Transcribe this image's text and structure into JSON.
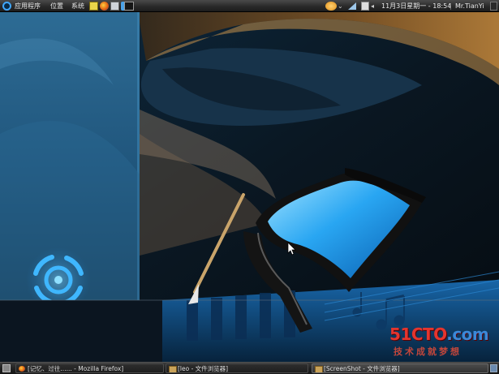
{
  "top_panel": {
    "menus": [
      "应用程序",
      "位置",
      "系统"
    ],
    "clock": "11月3日星期一 - 18:54",
    "user": "Mr.TianYi"
  },
  "taskbar": {
    "items": [
      {
        "label": "[记忆、过往...... - Mozilla Firefox]",
        "active": false
      },
      {
        "label": "[leo - 文件浏览器]",
        "active": false
      },
      {
        "label": "[ScreenShot - 文件浏览器]",
        "active": true
      }
    ]
  },
  "watermark": {
    "logo": "51CTO",
    "logo_suffix": ".com",
    "subtitle": "技术成就梦想"
  },
  "colors": {
    "accent_blue": "#1e9be8",
    "panel": "#2a2a2a",
    "watermark_red": "#e4352e"
  }
}
